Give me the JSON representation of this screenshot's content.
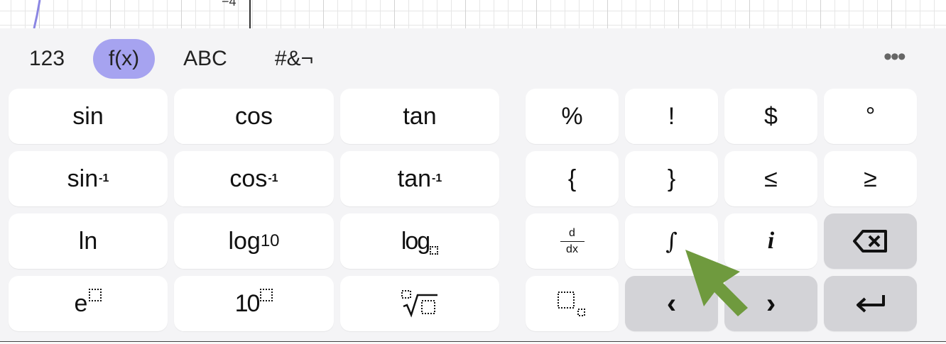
{
  "graph": {
    "tick_label": "−4",
    "curve_color": "#8b86e3"
  },
  "tabs": [
    {
      "label": "123",
      "active": false
    },
    {
      "label": "f(x)",
      "active": true
    },
    {
      "label": "ABC",
      "active": false
    },
    {
      "label": "#&¬",
      "active": false
    }
  ],
  "more_label": "•••",
  "keys": {
    "sin": "sin",
    "cos": "cos",
    "tan": "tan",
    "percent": "%",
    "factorial": "!",
    "dollar": "$",
    "degree": "°",
    "asin_base": "sin",
    "acos_base": "cos",
    "atan_base": "tan",
    "inverse": "-1",
    "lbrace": "{",
    "rbrace": "}",
    "le": "≤",
    "ge": "≥",
    "ln": "ln",
    "log10_base": "log",
    "log10_sub": "10",
    "logb_base": "log",
    "deriv_num": "d",
    "deriv_den": "dx",
    "integral": "∫",
    "imag": "i",
    "exp_base": "e",
    "pow10_base": "10",
    "left": "‹",
    "right": "›"
  },
  "colors": {
    "accent": "#a6a3f0",
    "key_bg": "#ffffff",
    "special_key_bg": "#d3d3d7",
    "keyboard_bg": "#f4f4f6",
    "pointer": "#6f9a3e"
  }
}
